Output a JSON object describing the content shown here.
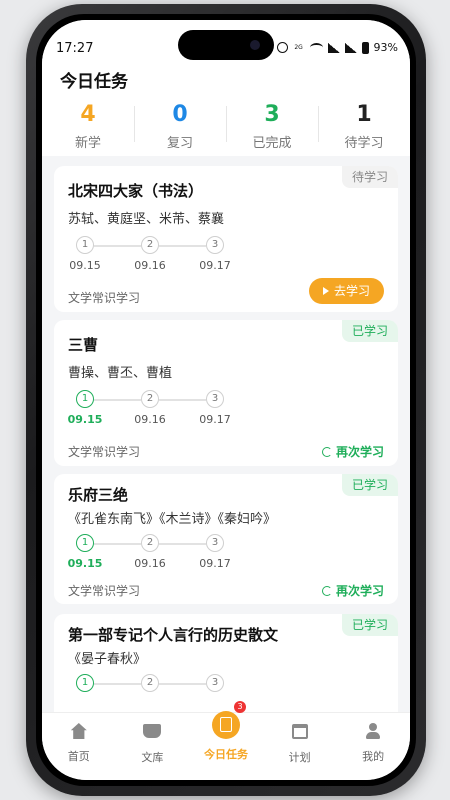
{
  "status": {
    "time": "17:27",
    "network_label": "2G",
    "battery": "93%"
  },
  "summary": {
    "title": "今日任务",
    "stats": [
      {
        "value": "4",
        "label": "新学",
        "color": "#f5a623"
      },
      {
        "value": "0",
        "label": "复习",
        "color": "#1e88e5"
      },
      {
        "value": "3",
        "label": "已完成",
        "color": "#1fae5a"
      },
      {
        "value": "1",
        "label": "待学习",
        "color": "#222222"
      }
    ]
  },
  "cards": [
    {
      "title": "北宋四大家（书法）",
      "subtitle": "苏轼、黄庭坚、米芾、蔡襄",
      "tag": "待学习",
      "steps": [
        {
          "num": "1",
          "date": "09.15"
        },
        {
          "num": "2",
          "date": "09.16"
        },
        {
          "num": "3",
          "date": "09.17"
        }
      ],
      "category": "文学常识学习",
      "action": "去学习"
    },
    {
      "title": "三曹",
      "subtitle": "曹操、曹丕、曹植",
      "tag": "已学习",
      "steps": [
        {
          "num": "1",
          "date": "09.15"
        },
        {
          "num": "2",
          "date": "09.16"
        },
        {
          "num": "3",
          "date": "09.17"
        }
      ],
      "category": "文学常识学习",
      "action": "再次学习"
    },
    {
      "title": "乐府三绝",
      "subtitle": "《孔雀东南飞》《木兰诗》《秦妇吟》",
      "tag": "已学习",
      "steps": [
        {
          "num": "1",
          "date": "09.15"
        },
        {
          "num": "2",
          "date": "09.16"
        },
        {
          "num": "3",
          "date": "09.17"
        }
      ],
      "category": "文学常识学习",
      "action": "再次学习"
    },
    {
      "title": "第一部专记个人言行的历史散文",
      "subtitle": "《晏子春秋》",
      "tag": "已学习",
      "steps": [
        {
          "num": "1"
        },
        {
          "num": "2"
        },
        {
          "num": "3"
        }
      ]
    }
  ],
  "tabbar": {
    "tabs": [
      {
        "label": "首页",
        "icon": "home-icon"
      },
      {
        "label": "文库",
        "icon": "book-icon"
      },
      {
        "label": "今日任务",
        "icon": "task-icon",
        "badge": "3"
      },
      {
        "label": "计划",
        "icon": "calendar-icon"
      },
      {
        "label": "我的",
        "icon": "user-icon"
      }
    ]
  },
  "colors": {
    "accent": "#f5a623",
    "success": "#1fae5a",
    "review": "#1e88e5"
  }
}
